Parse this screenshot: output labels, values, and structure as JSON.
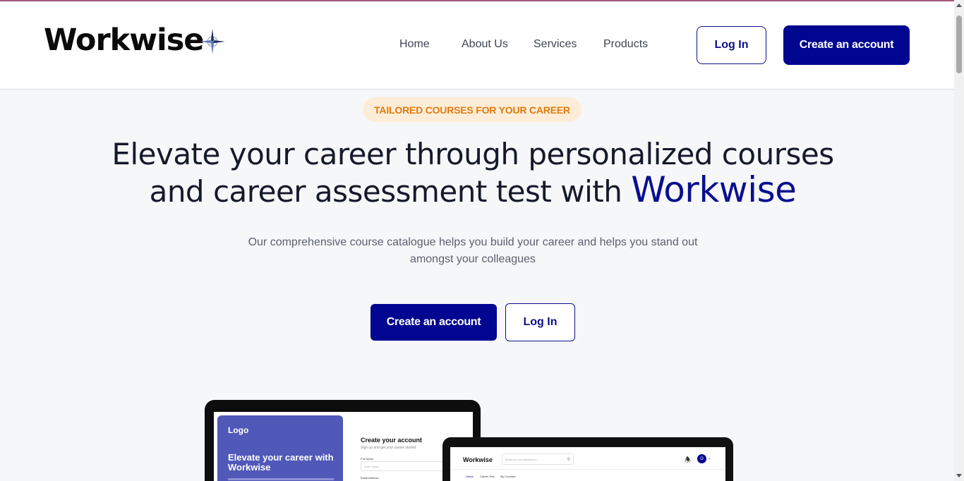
{
  "header": {
    "logo_text": "Workwise",
    "logo_icon": "compass-star-icon",
    "nav": [
      "Home",
      "About Us",
      "Services",
      "Products"
    ],
    "login_label": "Log In",
    "create_account_label": "Create an account"
  },
  "hero": {
    "badge": "TAILORED COURSES FOR YOUR CAREER",
    "headline_line1": "Elevate your career through personalized courses",
    "headline_line2": "and career assessment test with",
    "headline_brand": "Workwise",
    "subtitle": "Our comprehensive course catalogue helps you build your career and helps you stand out amongst your colleagues",
    "cta_create": "Create an account",
    "cta_login": "Log In"
  },
  "mockup_signup": {
    "panel_logo": "Logo",
    "panel_title": "Elevate your career with Workwise",
    "form_title": "Create your account",
    "form_subtitle": "Sign up and get your career started",
    "label_full_name": "Full Name",
    "full_name_placeholder": "Enter name",
    "label_email": "Email Address"
  },
  "mockup_dashboard": {
    "logo": "Workwise",
    "search_placeholder": "What are you looking for?",
    "avatar_initial": "O",
    "tabs": [
      "Home",
      "Career Test",
      "My Courses"
    ]
  },
  "colors": {
    "primary": "#00068f",
    "badge_bg": "#fdedd8",
    "badge_text": "#e07b0c",
    "page_bg": "#f6f7f9"
  }
}
